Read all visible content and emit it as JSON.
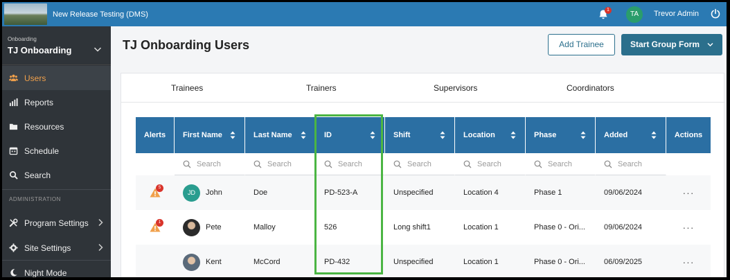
{
  "header": {
    "app_title": "New Release Testing (DMS)",
    "notification_count": "1",
    "user_initials": "TA",
    "user_name": "Trevor Admin"
  },
  "sidebar": {
    "program_caption": "Onboarding",
    "program_name": "TJ Onboarding",
    "items": [
      {
        "label": "Users",
        "icon": "users-icon",
        "active": true
      },
      {
        "label": "Reports",
        "icon": "bar-chart-icon"
      },
      {
        "label": "Resources",
        "icon": "folder-icon"
      },
      {
        "label": "Schedule",
        "icon": "calendar-icon"
      },
      {
        "label": "Search",
        "icon": "search-icon"
      }
    ],
    "admin_label": "ADMINISTRATION",
    "admin_items": [
      {
        "label": "Program Settings",
        "icon": "tools-icon"
      },
      {
        "label": "Site Settings",
        "icon": "gear-icon"
      },
      {
        "label": "Night Mode",
        "icon": "moon-icon"
      }
    ]
  },
  "page": {
    "title": "TJ Onboarding Users",
    "add_trainee_label": "Add Trainee",
    "start_group_form_label": "Start Group Form"
  },
  "tabs": [
    "Trainees",
    "Trainers",
    "Supervisors",
    "Coordinators"
  ],
  "table": {
    "columns": [
      "Alerts",
      "First Name",
      "Last Name",
      "ID",
      "Shift",
      "Location",
      "Phase",
      "Added",
      "Actions"
    ],
    "search_placeholder": "Search",
    "rows": [
      {
        "alerts": "5",
        "initials": "JD",
        "first": "John",
        "last": "Doe",
        "id": "PD-523-A",
        "shift": "Unspecified",
        "location": "Location 4",
        "phase": "Phase 1",
        "added": "09/06/2024",
        "actions": "···"
      },
      {
        "alerts": "1",
        "first": "Pete",
        "last": "Malloy",
        "id": "526",
        "shift": "Long shift1",
        "location": "Location 1",
        "phase": "Phase 0 - Ori...",
        "added": "09/06/2024",
        "actions": "···"
      },
      {
        "alerts": "",
        "first": "Kent",
        "last": "McCord",
        "id": "PD-432",
        "shift": "Unspecified",
        "location": "Location 1",
        "phase": "Phase 0 - Ori...",
        "added": "06/09/2025",
        "actions": "···"
      }
    ]
  },
  "colors": {
    "topbar": "#2b7ab3",
    "sidebar": "#2f3439",
    "active_nav": "#f0a04b",
    "table_header": "#2b6fa3",
    "primary_button": "#2b6f8c",
    "highlight": "#4bb543"
  }
}
